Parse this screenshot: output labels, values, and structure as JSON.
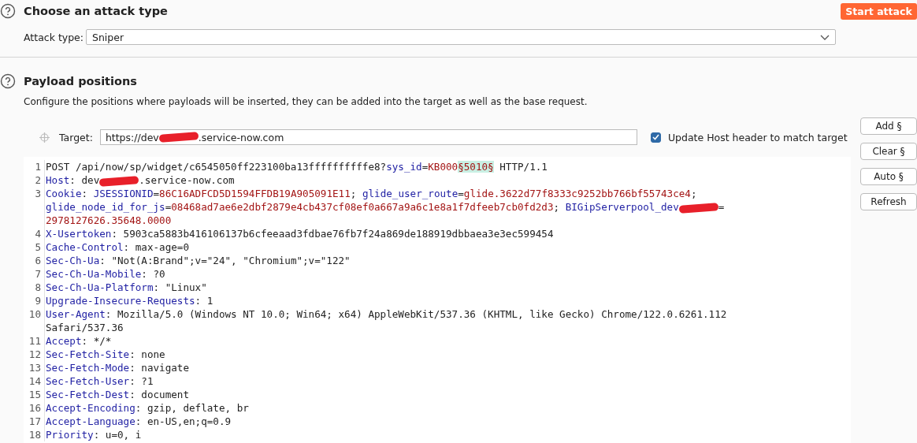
{
  "attack_type_section": {
    "title": "Choose an attack type",
    "start_button": "Start attack",
    "attack_type_label": "Attack type:",
    "attack_type_value": "Sniper"
  },
  "payload_positions": {
    "title": "Payload positions",
    "description": "Configure the positions where payloads will be inserted, they can be added into the target as well as the base request.",
    "target_label": "Target:",
    "target_value": [
      {
        "kind": "plain",
        "text": "https://dev"
      },
      {
        "kind": "redaction"
      },
      {
        "kind": "plain",
        "text": ".service-now.com"
      }
    ],
    "update_host": {
      "label": "Update Host header to match target",
      "checked": true
    },
    "buttons": [
      "Add §",
      "Clear §",
      "Auto §",
      "Refresh"
    ],
    "request_lines": [
      {
        "number": "1",
        "rows": [
          {
            "segments": [
              {
                "kind": "plain",
                "text": "POST /api/now/sp/widget/c6545050ff223100ba13ffffffffffe8?"
              },
              {
                "kind": "name",
                "text": "sys_id"
              },
              {
                "kind": "plain",
                "text": "="
              },
              {
                "kind": "value",
                "text": "KB000"
              },
              {
                "kind": "payload",
                "text": "§5010§"
              },
              {
                "kind": "plain",
                "text": " HTTP/1.1"
              }
            ]
          }
        ]
      },
      {
        "number": "2",
        "rows": [
          {
            "segments": [
              {
                "kind": "name",
                "text": "Host"
              },
              {
                "kind": "plain",
                "text": ": dev"
              },
              {
                "kind": "redaction"
              },
              {
                "kind": "plain",
                "text": ".service-now.com"
              }
            ]
          }
        ]
      },
      {
        "number": "3",
        "rows": [
          {
            "segments": [
              {
                "kind": "name",
                "text": "Cookie"
              },
              {
                "kind": "plain",
                "text": ": "
              },
              {
                "kind": "name",
                "text": "JSESSIONID"
              },
              {
                "kind": "plain",
                "text": "="
              },
              {
                "kind": "value",
                "text": "86C16ADFCD5D1594FFDB19A905091E11"
              },
              {
                "kind": "plain",
                "text": "; "
              },
              {
                "kind": "name",
                "text": "glide_user_route"
              },
              {
                "kind": "plain",
                "text": "="
              },
              {
                "kind": "value",
                "text": "glide.3622d77f8333c9252bb766bf55743ce4"
              },
              {
                "kind": "plain",
                "text": ";"
              }
            ]
          },
          {
            "segments": [
              {
                "kind": "name",
                "text": "glide_node_id_for_js"
              },
              {
                "kind": "plain",
                "text": "="
              },
              {
                "kind": "value",
                "text": "08468ad7ae6e2dbf2879e4cb437cf08ef0a667a9a6c1e8a1f7dfeeb7cb0fd2d3"
              },
              {
                "kind": "plain",
                "text": "; "
              },
              {
                "kind": "name",
                "text": "BIGipServerpool_dev"
              },
              {
                "kind": "redaction"
              },
              {
                "kind": "plain",
                "text": "="
              }
            ]
          },
          {
            "segments": [
              {
                "kind": "value",
                "text": "2978127626.35648.0000"
              }
            ]
          }
        ]
      },
      {
        "number": "4",
        "rows": [
          {
            "segments": [
              {
                "kind": "name",
                "text": "X-Usertoken"
              },
              {
                "kind": "plain",
                "text": ": 5903ca5883b416106137b6cfeeaad3fdbae76fb7f24a869de188919dbbaea3e3ec599454"
              }
            ]
          }
        ]
      },
      {
        "number": "5",
        "rows": [
          {
            "segments": [
              {
                "kind": "name",
                "text": "Cache-Control"
              },
              {
                "kind": "plain",
                "text": ": max-age=0"
              }
            ]
          }
        ]
      },
      {
        "number": "6",
        "rows": [
          {
            "segments": [
              {
                "kind": "name",
                "text": "Sec-Ch-Ua"
              },
              {
                "kind": "plain",
                "text": ": \"Not(A:Brand\";v=\"24\", \"Chromium\";v=\"122\""
              }
            ]
          }
        ]
      },
      {
        "number": "7",
        "rows": [
          {
            "segments": [
              {
                "kind": "name",
                "text": "Sec-Ch-Ua-Mobile"
              },
              {
                "kind": "plain",
                "text": ": ?0"
              }
            ]
          }
        ]
      },
      {
        "number": "8",
        "rows": [
          {
            "segments": [
              {
                "kind": "name",
                "text": "Sec-Ch-Ua-Platform"
              },
              {
                "kind": "plain",
                "text": ": \"Linux\""
              }
            ]
          }
        ]
      },
      {
        "number": "9",
        "rows": [
          {
            "segments": [
              {
                "kind": "name",
                "text": "Upgrade-Insecure-Requests"
              },
              {
                "kind": "plain",
                "text": ": 1"
              }
            ]
          }
        ]
      },
      {
        "number": "10",
        "rows": [
          {
            "segments": [
              {
                "kind": "name",
                "text": "User-Agent"
              },
              {
                "kind": "plain",
                "text": ": Mozilla/5.0 (Windows NT 10.0; Win64; x64) AppleWebKit/537.36 (KHTML, like Gecko) Chrome/122.0.6261.112"
              }
            ]
          },
          {
            "segments": [
              {
                "kind": "plain",
                "text": "Safari/537.36"
              }
            ]
          }
        ]
      },
      {
        "number": "11",
        "rows": [
          {
            "segments": [
              {
                "kind": "name",
                "text": "Accept"
              },
              {
                "kind": "plain",
                "text": ": */*"
              }
            ]
          }
        ]
      },
      {
        "number": "12",
        "rows": [
          {
            "segments": [
              {
                "kind": "name",
                "text": "Sec-Fetch-Site"
              },
              {
                "kind": "plain",
                "text": ": none"
              }
            ]
          }
        ]
      },
      {
        "number": "13",
        "rows": [
          {
            "segments": [
              {
                "kind": "name",
                "text": "Sec-Fetch-Mode"
              },
              {
                "kind": "plain",
                "text": ": navigate"
              }
            ]
          }
        ]
      },
      {
        "number": "14",
        "rows": [
          {
            "segments": [
              {
                "kind": "name",
                "text": "Sec-Fetch-User"
              },
              {
                "kind": "plain",
                "text": ": ?1"
              }
            ]
          }
        ]
      },
      {
        "number": "15",
        "rows": [
          {
            "segments": [
              {
                "kind": "name",
                "text": "Sec-Fetch-Dest"
              },
              {
                "kind": "plain",
                "text": ": document"
              }
            ]
          }
        ]
      },
      {
        "number": "16",
        "rows": [
          {
            "segments": [
              {
                "kind": "name",
                "text": "Accept-Encoding"
              },
              {
                "kind": "plain",
                "text": ": gzip, deflate, br"
              }
            ]
          }
        ]
      },
      {
        "number": "17",
        "rows": [
          {
            "segments": [
              {
                "kind": "name",
                "text": "Accept-Language"
              },
              {
                "kind": "plain",
                "text": ": en-US,en;q=0.9"
              }
            ]
          }
        ]
      },
      {
        "number": "18",
        "rows": [
          {
            "segments": [
              {
                "kind": "name",
                "text": "Priority"
              },
              {
                "kind": "plain",
                "text": ": u=0, i"
              }
            ]
          }
        ]
      }
    ]
  }
}
